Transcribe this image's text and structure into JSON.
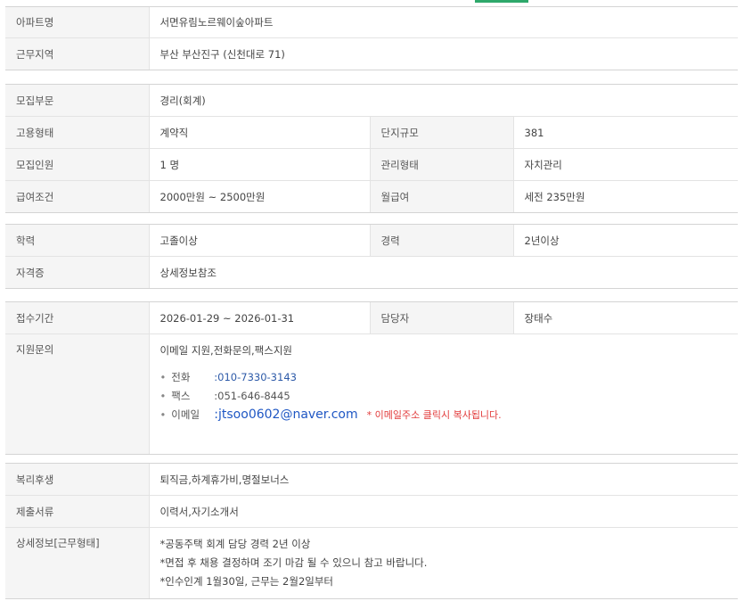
{
  "section1": {
    "apt_label": "아파트명",
    "apt_value": "서면유림노르웨이숲아파트",
    "region_label": "근무지역",
    "region_value": "부산  부산진구 (신천대로 71)"
  },
  "section2": {
    "dept_label": "모집부문",
    "dept_value": "경리(회계)",
    "emp_type_label": "고용형태",
    "emp_type_value": "계약직",
    "complex_size_label": "단지규모",
    "complex_size_value": "381",
    "headcount_label": "모집인원",
    "headcount_value": "1 명",
    "mgmt_type_label": "관리형태",
    "mgmt_type_value": "자치관리",
    "salary_label": "급여조건",
    "salary_value": "2000만원 ~ 2500만원",
    "monthly_label": "월급여",
    "monthly_value": "세전 235만원"
  },
  "section3": {
    "edu_label": "학력",
    "edu_value": "고졸이상",
    "career_label": "경력",
    "career_value": "2년이상",
    "cert_label": "자격증",
    "cert_value": "상세정보참조"
  },
  "section4": {
    "period_label": "접수기간",
    "period_value": "2026-01-29 ~ 2026-01-31",
    "manager_label": "담당자",
    "manager_value": "장태수",
    "inquiry_label": "지원문의",
    "inquiry_value": "이메일 지원,전화문의,팩스지원",
    "bullet": "•",
    "phone_label": "전화",
    "phone_value": ":010-7330-3143",
    "fax_label": "팩스",
    "fax_value": ":051-646-8445",
    "email_label": "이메일",
    "email_value": ":jtsoo0602@naver.com",
    "email_note": "* 이메일주소 클릭시 복사됩니다."
  },
  "section5": {
    "welfare_label": "복리후생",
    "welfare_value": "퇴직금,하계휴가비,명절보너스",
    "docs_label": "제출서류",
    "docs_value": "이력서,자기소개서",
    "detail_label": "상세정보[근무형태]",
    "detail_lines": [
      "*공동주택 회계 담당 경력 2년 이상",
      "*면접 후 채용 결정하며 조기 마감 될 수 있으니 참고 바랍니다.",
      "*인수인계 1월30일, 근무는 2월2일부터"
    ]
  }
}
